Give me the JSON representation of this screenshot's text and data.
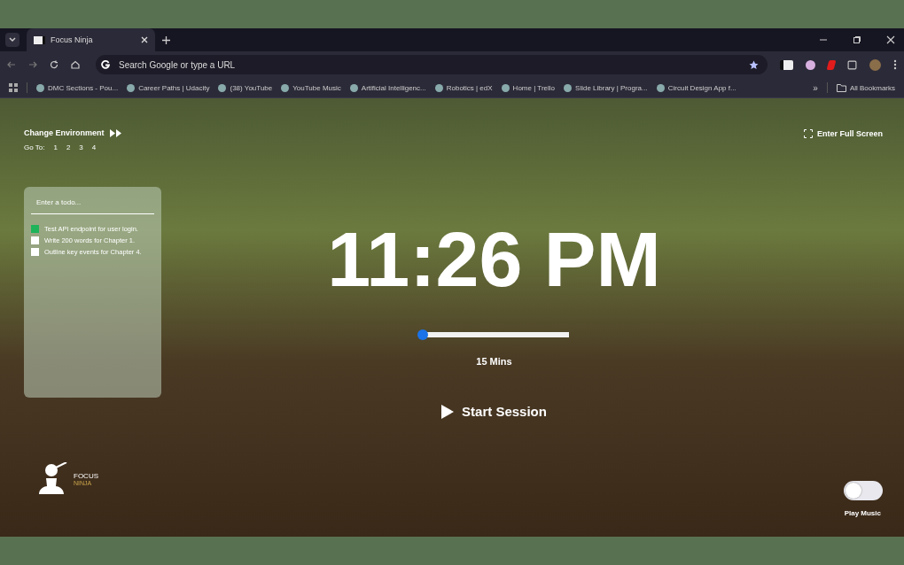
{
  "browser": {
    "tab": {
      "title": "Focus Ninja"
    },
    "omnibox": {
      "placeholder": "Search Google or type a URL"
    },
    "bookmarks": [
      {
        "label": "DMC Sections - Pou..."
      },
      {
        "label": "Career Paths | Udacity"
      },
      {
        "label": "(38) YouTube"
      },
      {
        "label": "YouTube Music"
      },
      {
        "label": "Artificial Intelligenc..."
      },
      {
        "label": "Robotics | edX"
      },
      {
        "label": "Home | Trello"
      },
      {
        "label": "Slide Library | Progra..."
      },
      {
        "label": "Circuit Design App f..."
      }
    ],
    "more_bookmarks": "»",
    "all_bookmarks": "All Bookmarks"
  },
  "app": {
    "change_environment": "Change Environment",
    "go_to": {
      "label": "Go To:",
      "options": [
        "1",
        "2",
        "3",
        "4"
      ]
    },
    "todo": {
      "placeholder": "Enter a todo...",
      "items": [
        {
          "text": "Test API endpoint for user login.",
          "checked": true
        },
        {
          "text": "Write 200 words for Chapter 1.",
          "checked": false
        },
        {
          "text": "Outline key events for Chapter 4.",
          "checked": false
        }
      ]
    },
    "clock": "11:26 PM",
    "duration": {
      "level": 0.0,
      "label": "15 Mins"
    },
    "start_button": "Start Session",
    "fullscreen": "Enter Full Screen",
    "music": {
      "on": false,
      "label": "Play Music"
    },
    "logo": {
      "line1": "FOCUS",
      "line2": "NINJA"
    }
  }
}
